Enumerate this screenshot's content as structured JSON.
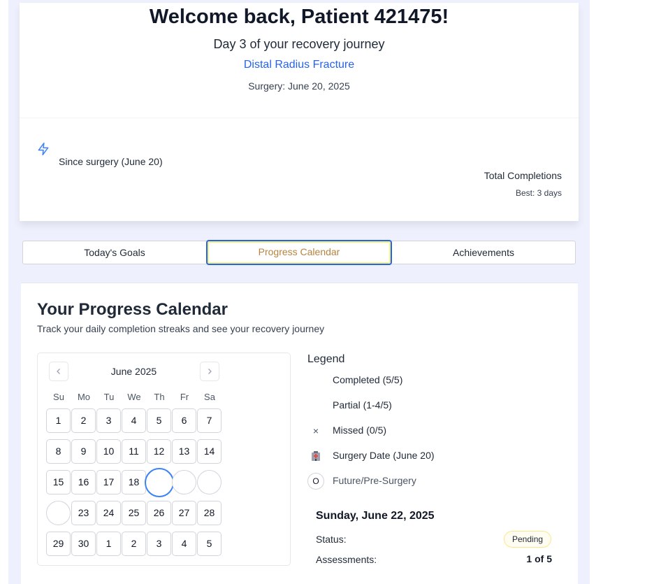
{
  "header": {
    "welcome": "Welcome back, Patient 421475!",
    "day_line": "Day 3 of your recovery journey",
    "condition": "Distal Radius Fracture",
    "surgery": "Surgery: June 20, 2025"
  },
  "stats": {
    "icon": "lightning-bolt-icon",
    "since_surgery": "Since surgery (June 20)",
    "total_completions": "Total Completions",
    "best": "Best: 3 days"
  },
  "tabs": [
    {
      "label": "Today's Goals"
    },
    {
      "label": "Progress Calendar",
      "active": true
    },
    {
      "label": "Achievements"
    }
  ],
  "calendar": {
    "title": "Your Progress Calendar",
    "subtitle": "Track your daily completion streaks and see your recovery journey",
    "month": "June 2025",
    "prev_icon": "chevron-left-icon",
    "next_icon": "chevron-right-icon",
    "weekdays": [
      "Su",
      "Mo",
      "Tu",
      "We",
      "Th",
      "Fr",
      "Sa"
    ],
    "weeks": [
      [
        {
          "d": "1"
        },
        {
          "d": "2"
        },
        {
          "d": "3"
        },
        {
          "d": "4"
        },
        {
          "d": "5"
        },
        {
          "d": "6"
        },
        {
          "d": "7"
        }
      ],
      [
        {
          "d": "8"
        },
        {
          "d": "9"
        },
        {
          "d": "10"
        },
        {
          "d": "11"
        },
        {
          "d": "12"
        },
        {
          "d": "13"
        },
        {
          "d": "14"
        }
      ],
      [
        {
          "d": "15"
        },
        {
          "d": "16"
        },
        {
          "d": "17"
        },
        {
          "d": "18"
        },
        {
          "d": "",
          "state": "today"
        },
        {
          "d": "",
          "state": "circle"
        },
        {
          "d": "",
          "state": "circle"
        }
      ],
      [
        {
          "d": "",
          "state": "circle"
        },
        {
          "d": "23"
        },
        {
          "d": "24"
        },
        {
          "d": "25"
        },
        {
          "d": "26"
        },
        {
          "d": "27"
        },
        {
          "d": "28"
        }
      ],
      [
        {
          "d": "29"
        },
        {
          "d": "30"
        },
        {
          "d": "1"
        },
        {
          "d": "2"
        },
        {
          "d": "3"
        },
        {
          "d": "4"
        },
        {
          "d": "5"
        }
      ]
    ]
  },
  "legend": {
    "title": "Legend",
    "completed": "Completed (5/5)",
    "partial": "Partial (1-4/5)",
    "missed": "Missed (0/5)",
    "missed_icon": "×",
    "surgery": "Surgery Date (June 20)",
    "surgery_icon": "hospital-icon",
    "future": "Future/Pre-Surgery",
    "future_icon": "O"
  },
  "detail": {
    "date": "Sunday, June 22, 2025",
    "status_label": "Status:",
    "status_value": "Pending",
    "assessments_label": "Assessments:",
    "assessments_value": "1 of 5"
  },
  "colors": {
    "accent": "#2563eb",
    "active_tab_text": "#b7833f",
    "page_panel": "#eef0fd"
  }
}
